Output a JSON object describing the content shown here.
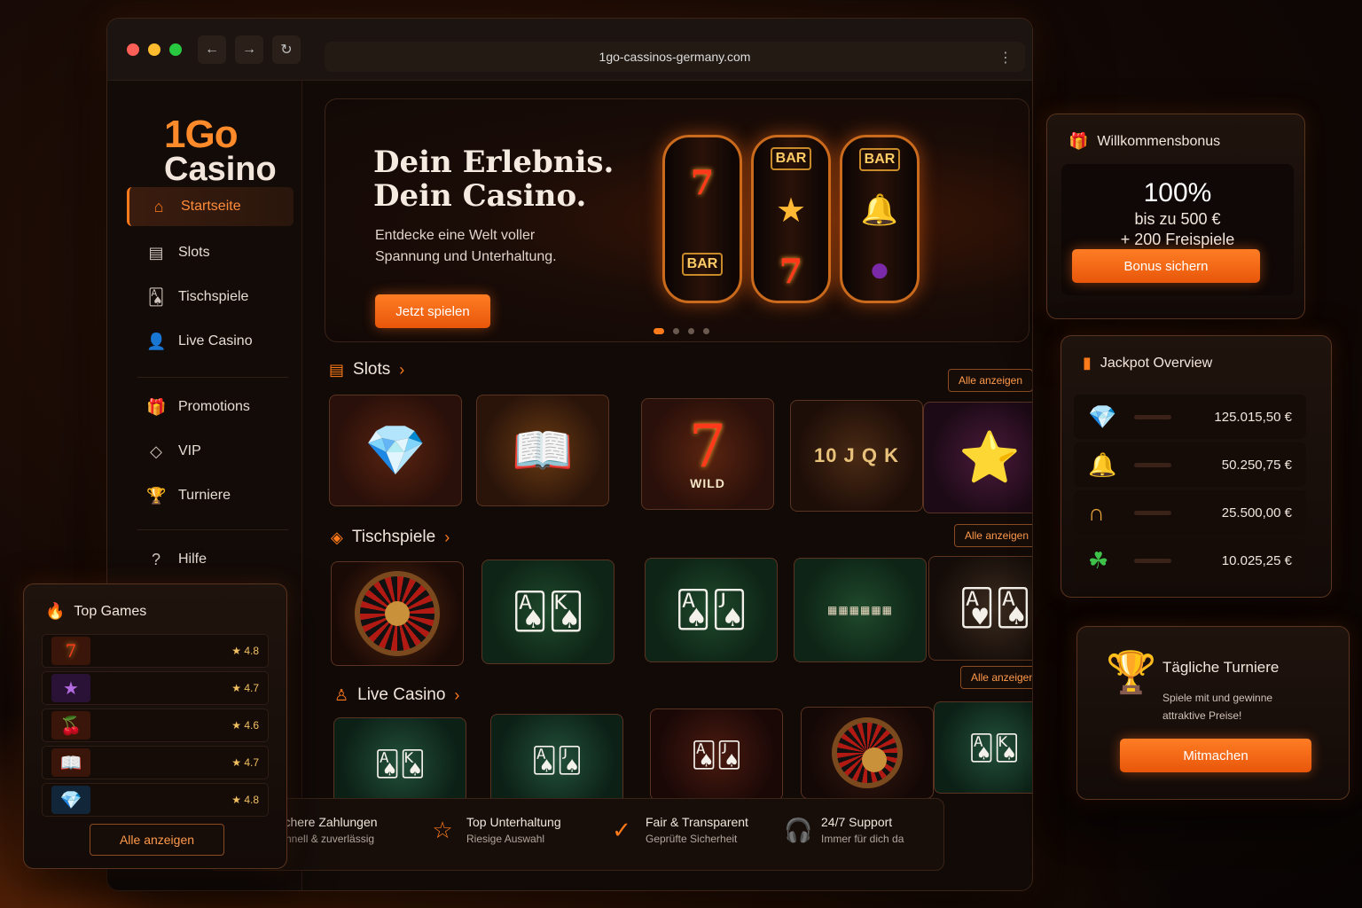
{
  "browser": {
    "url": "1go-cassinos-germany.com",
    "nav": {
      "back": "←",
      "forward": "→",
      "reload": "↻",
      "menu": "⋮"
    }
  },
  "logo": {
    "line1": "1Go",
    "line2": "Casino"
  },
  "sidebar": {
    "items": [
      {
        "label": "Startseite",
        "icon": "home-icon",
        "glyph": "⌂"
      },
      {
        "label": "Slots",
        "icon": "slot-machine-icon",
        "glyph": "▤"
      },
      {
        "label": "Tischspiele",
        "icon": "cards-icon",
        "glyph": "🂡"
      },
      {
        "label": "Live Casino",
        "icon": "person-icon",
        "glyph": "👤"
      },
      {
        "label": "Promotions",
        "icon": "gift-icon",
        "glyph": "🎁"
      },
      {
        "label": "VIP",
        "icon": "diamond-icon",
        "glyph": "◇"
      },
      {
        "label": "Turniere",
        "icon": "trophy-icon",
        "glyph": "🏆"
      },
      {
        "label": "Hilfe",
        "icon": "help-icon",
        "glyph": "?"
      }
    ]
  },
  "hero": {
    "title_line1": "Dein Erlebnis.",
    "title_line2": "Dein Casino.",
    "subtitle": "Entdecke eine Welt voller Spannung und Unterhaltung.",
    "cta": "Jetzt spielen",
    "reels": [
      [
        "7",
        "BAR"
      ],
      [
        "BAR",
        "★",
        "7"
      ],
      [
        "BAR",
        "🔔",
        "●"
      ]
    ],
    "carousel_active": 1,
    "carousel_count": 4
  },
  "sections": {
    "slots": {
      "title": "Slots",
      "view_all": "Alle anzeigen",
      "chevron": "›"
    },
    "table": {
      "title": "Tischspiele",
      "view_all": "Alle anzeigen",
      "chevron": "›"
    },
    "live": {
      "title": "Live Casino",
      "view_all": "Alle anzeigen",
      "chevron": "›"
    }
  },
  "slot_tiles": [
    {
      "icon": "diamond-fruits-icon",
      "glyph": "💎"
    },
    {
      "icon": "book-icon",
      "glyph": "📖"
    },
    {
      "icon": "wild-seven-icon",
      "glyph": "7",
      "label": "WILD"
    },
    {
      "icon": "egypt-cards-icon",
      "glyph": "10 J Q K"
    },
    {
      "icon": "star-fruits-icon",
      "glyph": "⭐"
    }
  ],
  "features": [
    {
      "title": "Sichere Zahlungen",
      "sub": "Schnell & zuverlässig",
      "icon": "shield-check-icon",
      "glyph": "⛉"
    },
    {
      "title": "Top Unterhaltung",
      "sub": "Riesige Auswahl",
      "icon": "star-outline-icon",
      "glyph": "☆"
    },
    {
      "title": "Fair & Transparent",
      "sub": "Geprüfte Sicherheit",
      "icon": "check-circle-icon",
      "glyph": "✓"
    },
    {
      "title": "24/7 Support",
      "sub": "Immer für dich da",
      "icon": "headset-icon",
      "glyph": "🎧"
    }
  ],
  "bonus": {
    "title": "Willkommensbonus",
    "percent": "100%",
    "line1": "bis zu 500 €",
    "line2": "+ 200 Freispiele",
    "cta": "Bonus sichern"
  },
  "jackpot": {
    "title": "Jackpot Overview",
    "rows": [
      {
        "icon": "diamond-icon",
        "glyph": "💎",
        "amount": "125.015,50 €"
      },
      {
        "icon": "bell-icon",
        "glyph": "🔔",
        "amount": "50.250,75 €"
      },
      {
        "icon": "horseshoe-icon",
        "glyph": "∩",
        "amount": "25.500,00 €"
      },
      {
        "icon": "clover-icon",
        "glyph": "☘",
        "amount": "10.025,25 €"
      }
    ]
  },
  "tournaments": {
    "title": "Tägliche Turniere",
    "sub": "Spiele mit und gewinne attraktive Preise!",
    "cta": "Mitmachen"
  },
  "top_games": {
    "title": "Top Games",
    "rows": [
      {
        "icon": "seven-icon",
        "glyph": "7",
        "rating": "4.8"
      },
      {
        "icon": "star-icon",
        "glyph": "★",
        "rating": "4.7"
      },
      {
        "icon": "fruits-icon",
        "glyph": "🍒",
        "rating": "4.6"
      },
      {
        "icon": "book-icon",
        "glyph": "📖",
        "rating": "4.7"
      },
      {
        "icon": "diamond-icon",
        "glyph": "💎",
        "rating": "4.8"
      }
    ],
    "view_all": "Alle anzeigen"
  },
  "colors": {
    "accent": "#ff7a1a",
    "background": "#120805"
  }
}
